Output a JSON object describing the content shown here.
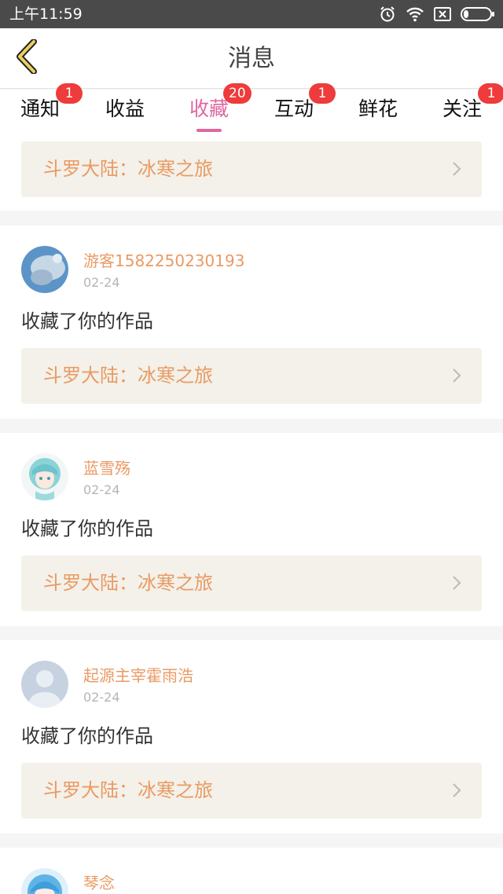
{
  "status_bar": {
    "time": "上午11:59",
    "icons": [
      "alarm-icon",
      "wifi-icon",
      "sim-icon",
      "battery-icon"
    ]
  },
  "header": {
    "title": "消息",
    "back_icon": "chevron-left-icon",
    "back_color": "#e8d160"
  },
  "tabs": [
    {
      "label": "通知",
      "badge": "1"
    },
    {
      "label": "收益",
      "badge": ""
    },
    {
      "label": "收藏",
      "badge": "20",
      "active": true
    },
    {
      "label": "互动",
      "badge": "1"
    },
    {
      "label": "鲜花",
      "badge": ""
    },
    {
      "label": "关注",
      "badge": "1"
    }
  ],
  "colors": {
    "accent": "#e066a0",
    "badge": "#ee3b3b",
    "name": "#ea9a64",
    "link_bg": "#f3f1e9"
  },
  "messages": [
    {
      "work": "斗罗大陆：冰寒之旅"
    },
    {
      "user": "游客1582250230193",
      "date": "02-24",
      "action": "收藏了你的作品",
      "work": "斗罗大陆：冰寒之旅"
    },
    {
      "user": "蓝雪殇",
      "date": "02-24",
      "action": "收藏了你的作品",
      "work": "斗罗大陆：冰寒之旅"
    },
    {
      "user": "起源主宰霍雨浩",
      "date": "02-24",
      "action": "收藏了你的作品",
      "work": "斗罗大陆：冰寒之旅"
    },
    {
      "user": "琴念"
    }
  ]
}
